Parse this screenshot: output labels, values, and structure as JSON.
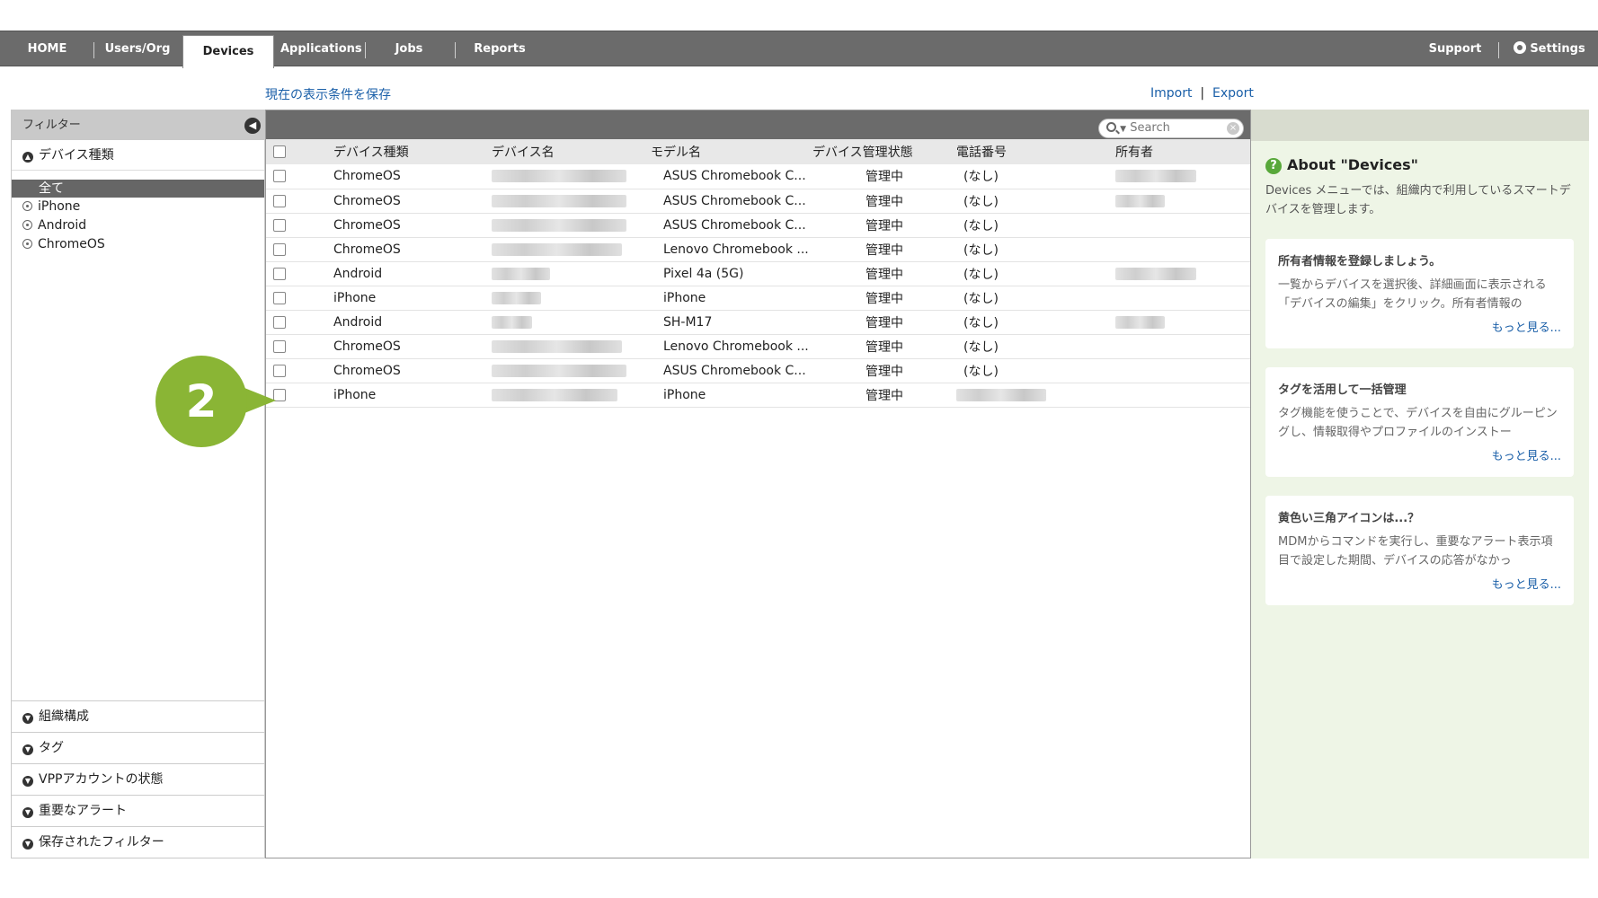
{
  "nav": {
    "items": [
      "HOME",
      "Users/Org",
      "Devices",
      "Applications",
      "Jobs",
      "Reports"
    ],
    "active": "Devices",
    "support": "Support",
    "settings": "Settings"
  },
  "links": {
    "save_view": "現在の表示条件を保存",
    "import": "Import",
    "separator": "|",
    "export": "Export"
  },
  "filter": {
    "title": "フィルター",
    "device_type_header": "デバイス種類",
    "types": [
      "全て",
      "iPhone",
      "Android",
      "ChromeOS"
    ],
    "bottom_sections": [
      "組織構成",
      "タグ",
      "VPPアカウントの状態",
      "重要なアラート",
      "保存されたフィルター"
    ]
  },
  "search": {
    "placeholder": "Search"
  },
  "table": {
    "columns": [
      "デバイス種類",
      "デバイス名",
      "モデル名",
      "デバイス管理状態",
      "電話番号",
      "所有者"
    ],
    "rows": [
      {
        "type": "ChromeOS",
        "model": "ASUS Chromebook C...",
        "status": "管理中",
        "phone": "(なし)"
      },
      {
        "type": "ChromeOS",
        "model": "ASUS Chromebook C...",
        "status": "管理中",
        "phone": "(なし)"
      },
      {
        "type": "ChromeOS",
        "model": "ASUS Chromebook C...",
        "status": "管理中",
        "phone": "(なし)"
      },
      {
        "type": "ChromeOS",
        "model": "Lenovo Chromebook ...",
        "status": "管理中",
        "phone": "(なし)"
      },
      {
        "type": "Android",
        "model": "Pixel 4a (5G)",
        "status": "管理中",
        "phone": "(なし)"
      },
      {
        "type": "iPhone",
        "model": "iPhone",
        "status": "管理中",
        "phone": "(なし)"
      },
      {
        "type": "Android",
        "model": "SH-M17",
        "status": "管理中",
        "phone": "(なし)"
      },
      {
        "type": "ChromeOS",
        "model": "Lenovo Chromebook ...",
        "status": "管理中",
        "phone": "(なし)"
      },
      {
        "type": "ChromeOS",
        "model": "ASUS Chromebook C...",
        "status": "管理中",
        "phone": "(なし)"
      },
      {
        "type": "iPhone",
        "model": "iPhone",
        "status": "管理中",
        "phone": ""
      }
    ]
  },
  "marker": {
    "label": "2",
    "color": "#8ab535"
  },
  "help": {
    "title": "About \"Devices\"",
    "description": "Devices メニューでは、組織内で利用しているスマートデバイスを管理します。",
    "cards": [
      {
        "title": "所有者情報を登録しましょう。",
        "body": "一覧からデバイスを選択後、詳細画面に表示される「デバイスの編集」をクリック。所有者情報の",
        "more": "もっと見る..."
      },
      {
        "title": "タグを活用して一括管理",
        "body": "タグ機能を使うことで、デバイスを自由にグルーピングし、情報取得やプロファイルのインストー",
        "more": "もっと見る..."
      },
      {
        "title": "黄色い三角アイコンは...？",
        "body": "MDMからコマンドを実行し、重要なアラート表示項目で設定した期間、デバイスの応答がなかっ",
        "more": "もっと見る..."
      }
    ]
  }
}
